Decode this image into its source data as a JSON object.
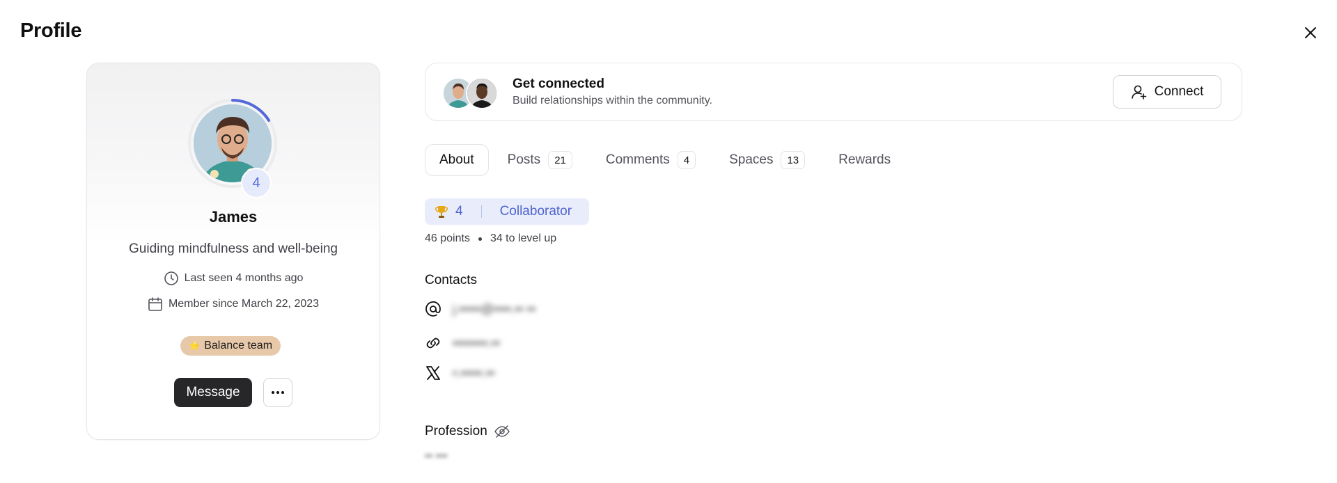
{
  "header": {
    "title": "Profile"
  },
  "profile": {
    "name": "James",
    "level": "4",
    "bio": "Guiding mindfulness and well-being",
    "last_seen": "Last seen 4 months ago",
    "member_since": "Member since March 22, 2023",
    "team_badge": {
      "emoji": "⭐",
      "label": "Balance team"
    },
    "message_label": "Message"
  },
  "connect": {
    "title": "Get connected",
    "subtitle": "Build relationships within the community.",
    "button_label": "Connect"
  },
  "tabs": [
    {
      "label": "About",
      "count": null,
      "active": true
    },
    {
      "label": "Posts",
      "count": "21"
    },
    {
      "label": "Comments",
      "count": "4"
    },
    {
      "label": "Spaces",
      "count": "13"
    },
    {
      "label": "Rewards",
      "count": null
    }
  ],
  "level": {
    "value": "4",
    "rank": "Collaborator",
    "points": "46 points",
    "to_level_up": "34 to level up"
  },
  "contacts": {
    "title": "Contacts",
    "email": "j.•••••@••••.•• ••",
    "website": "••••••••.••",
    "twitter": "•.•••••.••"
  },
  "profession": {
    "title": "Profession",
    "value": "•• •••"
  },
  "colors": {
    "accent": "#5468d9",
    "level_bg": "#e8ecfb",
    "team_badge_bg": "#e7c8a8",
    "dark_button": "#27272a"
  }
}
